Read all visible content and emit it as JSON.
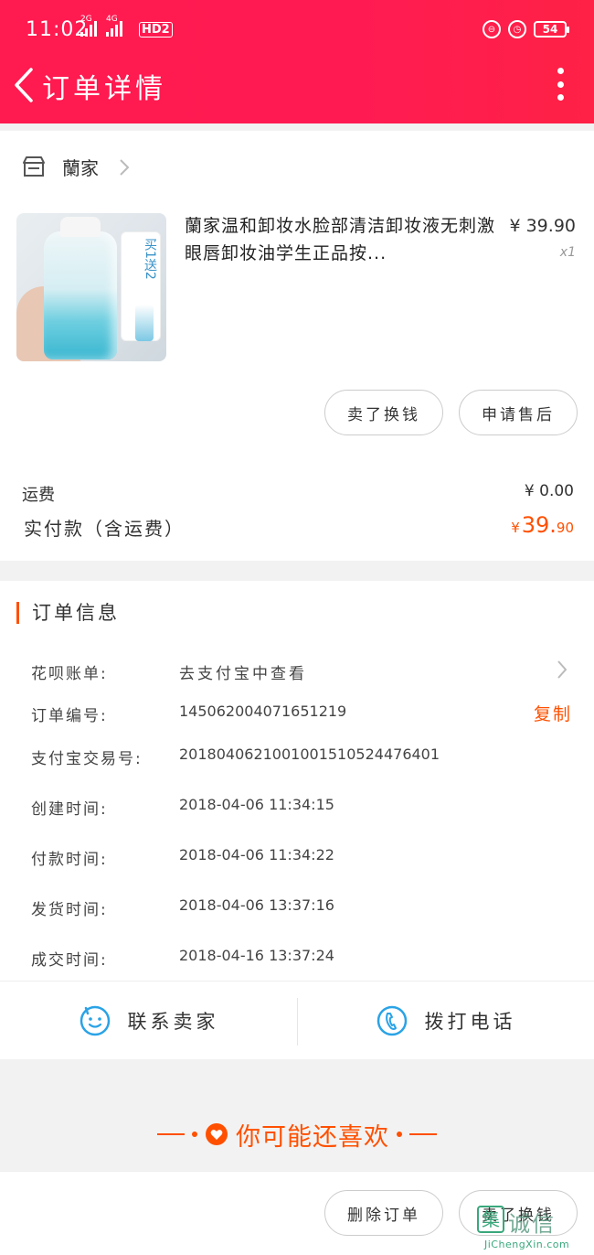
{
  "status": {
    "time": "11:02",
    "net1": "2G",
    "net2": "4G",
    "hd": "HD2",
    "battery": "54"
  },
  "nav": {
    "title": "订单详情"
  },
  "shop": {
    "name": "蘭家"
  },
  "product": {
    "title": "蘭家温和卸妆水脸部清洁卸妆液无刺激眼唇卸妆油学生正品按...",
    "price": "¥ 39.90",
    "qty": "x1",
    "promo": "买1送2"
  },
  "actions": {
    "sell_swap": "卖了换钱",
    "after_sale": "申请售后"
  },
  "fees": {
    "shipping_label": "运费",
    "shipping_value": "¥ 0.00",
    "paid_label": "实付款（含运费）",
    "paid_currency": "¥",
    "paid_int": "39.",
    "paid_dec": "90"
  },
  "order_info": {
    "title": "订单信息",
    "rows": [
      {
        "label": "花呗账单:",
        "value": "去支付宝中查看"
      },
      {
        "label": "订单编号:",
        "value": "145062004071651219",
        "action": "复制"
      },
      {
        "label": "支付宝交易号:",
        "value": "2018040621001001510524476401"
      },
      {
        "label": "创建时间:",
        "value": "2018-04-06 11:34:15"
      },
      {
        "label": "付款时间:",
        "value": "2018-04-06 11:34:22"
      },
      {
        "label": "发货时间:",
        "value": "2018-04-06 13:37:16"
      },
      {
        "label": "成交时间:",
        "value": "2018-04-16 13:37:24"
      }
    ]
  },
  "contact": {
    "seller": "联系卖家",
    "call": "拨打电话"
  },
  "recommend": {
    "label": "你可能还喜欢"
  },
  "bottom": {
    "delete": "删除订单",
    "sell_swap": "卖了换钱"
  },
  "watermark": {
    "logo": "集",
    "text": "诚信",
    "url": "JiChengXin.com"
  },
  "colors": {
    "header": "#ff1b52",
    "accent": "#ff5000"
  }
}
